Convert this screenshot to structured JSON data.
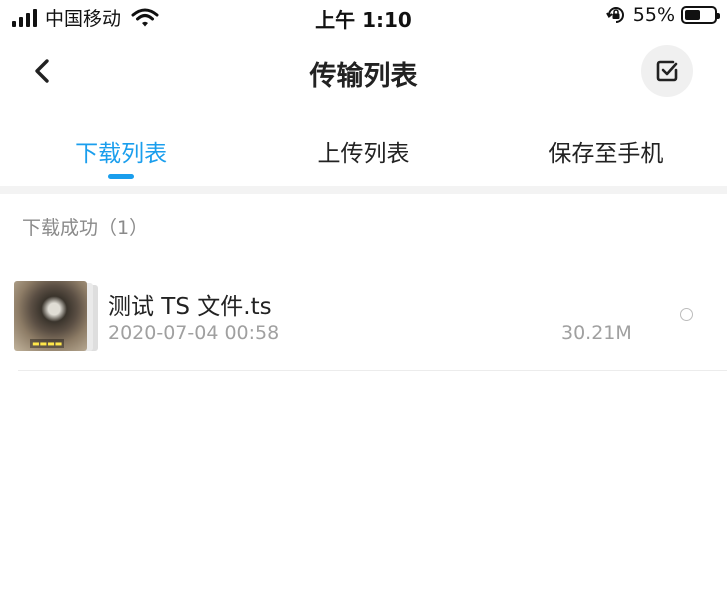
{
  "status_bar": {
    "carrier": "中国移动",
    "time": "上午 1:10",
    "battery_percent": "55%",
    "battery_level": 0.55,
    "icons": [
      "signal-icon",
      "wifi-icon",
      "orientation-lock-icon",
      "battery-icon"
    ]
  },
  "nav": {
    "title": "传输列表",
    "back_icon": "chevron-left-icon",
    "select_icon": "checkbox-icon"
  },
  "tabs": [
    {
      "label": "下载列表",
      "active": true
    },
    {
      "label": "上传列表",
      "active": false
    },
    {
      "label": "保存至手机",
      "active": false
    }
  ],
  "colors": {
    "accent": "#1a9eed",
    "secondary_text": "#a0a0a0",
    "section_text": "#8a8a8a"
  },
  "section": {
    "title": "下载成功（1）"
  },
  "items": [
    {
      "name": "测试 TS 文件.ts",
      "date": "2020-07-04 00:58",
      "size": "30.21M",
      "thumbnail_icon": "video-thumbnail-icon"
    }
  ]
}
